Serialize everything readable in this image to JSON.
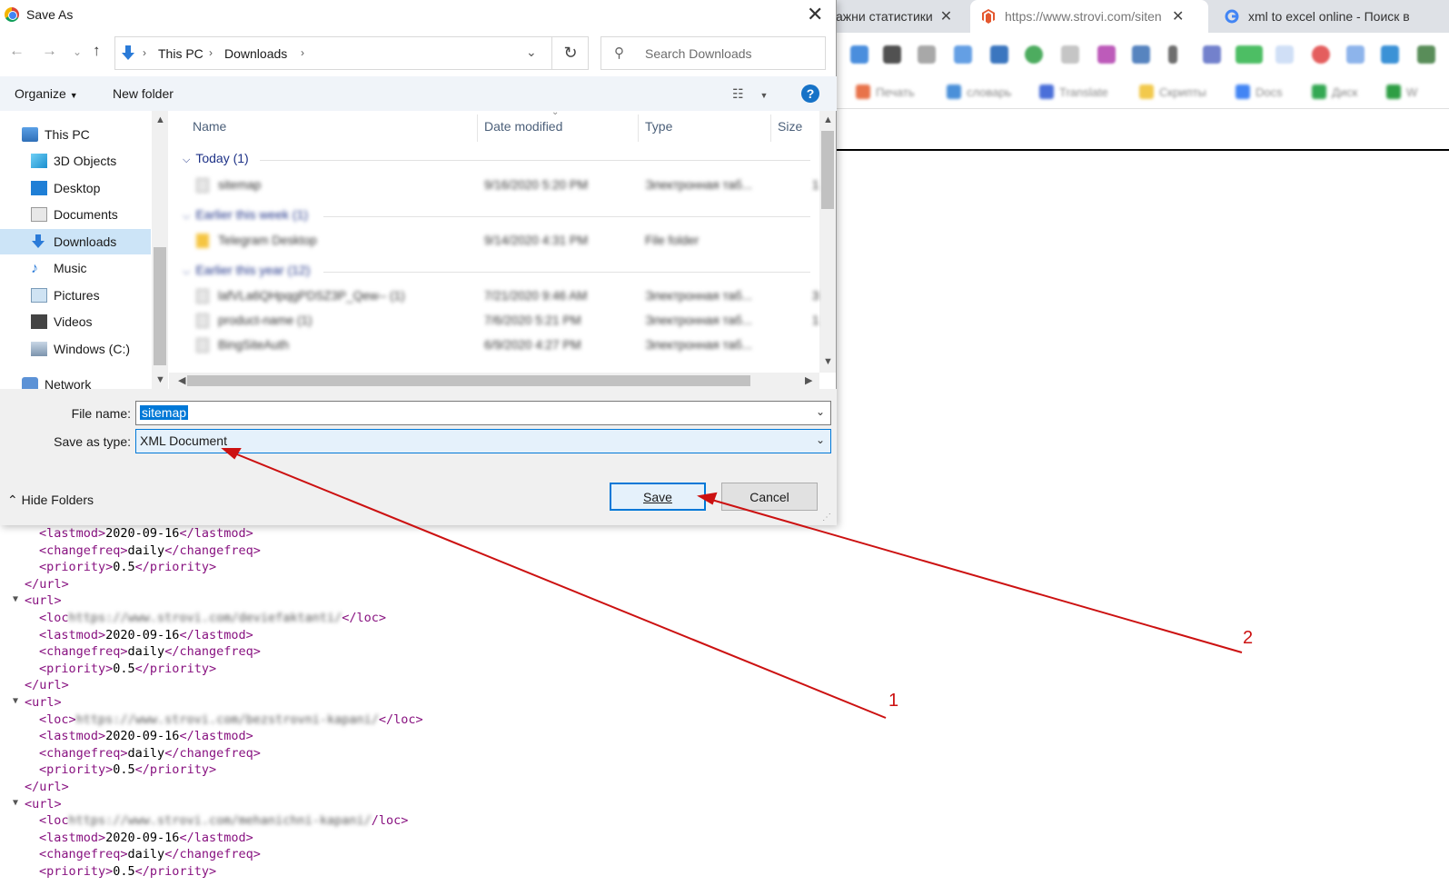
{
  "browser": {
    "tabs": [
      {
        "title": "ажни статистики"
      },
      {
        "title": "https://www.strovi.com/siten"
      },
      {
        "title": "xml to excel online - Поиск в"
      }
    ],
    "bookmarks": [
      "Печать",
      "словарь",
      "Translate",
      "Скрипты",
      "Docs",
      "Диск",
      "W"
    ]
  },
  "dialog": {
    "title": "Save As",
    "breadcrumb": [
      "This PC",
      "Downloads"
    ],
    "search_placeholder": "Search Downloads",
    "organize_label": "Organize",
    "new_folder_label": "New folder",
    "help_label": "?",
    "nav_items": [
      {
        "label": "This PC",
        "icon": "pc-icon"
      },
      {
        "label": "3D Objects",
        "icon": "cube-icon"
      },
      {
        "label": "Desktop",
        "icon": "desktop-icon"
      },
      {
        "label": "Documents",
        "icon": "documents-icon"
      },
      {
        "label": "Downloads",
        "icon": "download-arrow-icon",
        "selected": true
      },
      {
        "label": "Music",
        "icon": "music-note-icon"
      },
      {
        "label": "Pictures",
        "icon": "pictures-icon"
      },
      {
        "label": "Videos",
        "icon": "film-icon"
      },
      {
        "label": "Windows (C:)",
        "icon": "drive-icon"
      },
      {
        "label": "Network",
        "icon": "network-icon"
      }
    ],
    "columns": [
      "Name",
      "Date modified",
      "Type",
      "Size"
    ],
    "groups": [
      {
        "label": "Today (1)",
        "files": [
          {
            "name": "sitemap",
            "date": "9/16/2020 5:20 PM",
            "type": "Электронная таб...",
            "size": "1"
          }
        ]
      },
      {
        "label": "Earlier this week (1)",
        "files": [
          {
            "name": "Telegram Desktop",
            "date": "9/14/2020 4:31 PM",
            "type": "File folder",
            "size": ""
          }
        ]
      },
      {
        "label": "Earlier this year (12)",
        "files": [
          {
            "name": "lafVLa6QHpqgPDSZ3P_Qew-- (1)",
            "date": "7/21/2020 9:46 AM",
            "type": "Электронная таб...",
            "size": "3"
          },
          {
            "name": "product-name (1)",
            "date": "7/6/2020 5:21 PM",
            "type": "Электронная таб...",
            "size": "1"
          },
          {
            "name": "BingSiteAuth",
            "date": "6/9/2020 4:27 PM",
            "type": "Электронная таб...",
            "size": ""
          }
        ]
      }
    ],
    "file_name_label": "File name:",
    "file_name_value": "sitemap",
    "save_type_label": "Save as type:",
    "save_type_value": "XML Document",
    "save_label": "Save",
    "cancel_label": "Cancel",
    "hide_folders_label": "Hide Folders"
  },
  "xml_lines": [
    {
      "indent": 1,
      "parts": [
        [
          "tag",
          "<lastmod>"
        ],
        [
          "txt",
          "2020-09-16"
        ],
        [
          "tag",
          "</lastmod>"
        ]
      ]
    },
    {
      "indent": 1,
      "parts": [
        [
          "tag",
          "<changefreq>"
        ],
        [
          "txt",
          "daily"
        ],
        [
          "tag",
          "</changefreq>"
        ]
      ]
    },
    {
      "indent": 1,
      "parts": [
        [
          "tag",
          "<priority>"
        ],
        [
          "txt",
          "0.5"
        ],
        [
          "tag",
          "</priority>"
        ]
      ]
    },
    {
      "indent": 0,
      "parts": [
        [
          "tag",
          "</url>"
        ]
      ]
    },
    {
      "indent": 0,
      "toggle": true,
      "parts": [
        [
          "tag",
          "<url>"
        ]
      ]
    },
    {
      "indent": 1,
      "parts": [
        [
          "tag",
          "<loc"
        ],
        [
          "blur",
          "https://www.strovi.com/deviefaktanti/"
        ],
        [
          "tag",
          "</loc>"
        ]
      ]
    },
    {
      "indent": 1,
      "parts": [
        [
          "tag",
          "<lastmod>"
        ],
        [
          "txt",
          "2020-09-16"
        ],
        [
          "tag",
          "</lastmod>"
        ]
      ]
    },
    {
      "indent": 1,
      "parts": [
        [
          "tag",
          "<changefreq>"
        ],
        [
          "txt",
          "daily"
        ],
        [
          "tag",
          "</changefreq>"
        ]
      ]
    },
    {
      "indent": 1,
      "parts": [
        [
          "tag",
          "<priority>"
        ],
        [
          "txt",
          "0.5"
        ],
        [
          "tag",
          "</priority>"
        ]
      ]
    },
    {
      "indent": 0,
      "parts": [
        [
          "tag",
          "</url>"
        ]
      ]
    },
    {
      "indent": 0,
      "toggle": true,
      "parts": [
        [
          "tag",
          "<url>"
        ]
      ]
    },
    {
      "indent": 1,
      "parts": [
        [
          "tag",
          "<loc>"
        ],
        [
          "blur",
          "https://www.strovi.com/bezstrovni-kapani/"
        ],
        [
          "tag",
          "</loc>"
        ]
      ]
    },
    {
      "indent": 1,
      "parts": [
        [
          "tag",
          "<lastmod>"
        ],
        [
          "txt",
          "2020-09-16"
        ],
        [
          "tag",
          "</lastmod>"
        ]
      ]
    },
    {
      "indent": 1,
      "parts": [
        [
          "tag",
          "<changefreq>"
        ],
        [
          "txt",
          "daily"
        ],
        [
          "tag",
          "</changefreq>"
        ]
      ]
    },
    {
      "indent": 1,
      "parts": [
        [
          "tag",
          "<priority>"
        ],
        [
          "txt",
          "0.5"
        ],
        [
          "tag",
          "</priority>"
        ]
      ]
    },
    {
      "indent": 0,
      "parts": [
        [
          "tag",
          "</url>"
        ]
      ]
    },
    {
      "indent": 0,
      "toggle": true,
      "parts": [
        [
          "tag",
          "<url>"
        ]
      ]
    },
    {
      "indent": 1,
      "parts": [
        [
          "tag",
          "<loc"
        ],
        [
          "blur",
          "https://www.strovi.com/mehanichni-kapani/"
        ],
        [
          "tag",
          "/loc>"
        ]
      ]
    },
    {
      "indent": 1,
      "parts": [
        [
          "tag",
          "<lastmod>"
        ],
        [
          "txt",
          "2020-09-16"
        ],
        [
          "tag",
          "</lastmod>"
        ]
      ]
    },
    {
      "indent": 1,
      "parts": [
        [
          "tag",
          "<changefreq>"
        ],
        [
          "txt",
          "daily"
        ],
        [
          "tag",
          "</changefreq>"
        ]
      ]
    },
    {
      "indent": 1,
      "parts": [
        [
          "tag",
          "<priority>"
        ],
        [
          "txt",
          "0.5"
        ],
        [
          "tag",
          "</priority>"
        ]
      ]
    }
  ],
  "annotations": {
    "label_1": "1",
    "label_2": "2",
    "color": "#cc1111"
  }
}
